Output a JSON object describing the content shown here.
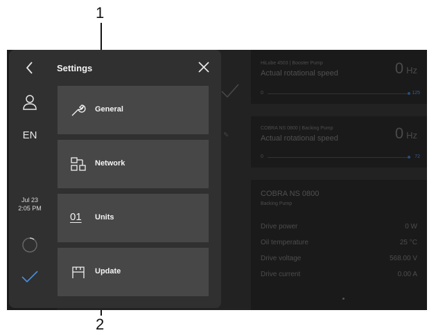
{
  "callouts": {
    "top": "1",
    "bottom": "2"
  },
  "settings": {
    "title": "Settings",
    "language": "EN",
    "date": "Jul 23",
    "time": "2:05 PM",
    "menu": [
      {
        "label": "General",
        "icon": "wrench-icon"
      },
      {
        "label": "Network",
        "icon": "network-icon"
      },
      {
        "label": "Units",
        "icon": "units-icon",
        "icon_text": "01"
      },
      {
        "label": "Update",
        "icon": "update-icon"
      }
    ]
  },
  "dashboard": {
    "pump1": {
      "name": "HiLobe 4503 | Booster Pump",
      "label": "Actual rotational speed",
      "value": "0",
      "unit": "Hz",
      "min": "0",
      "max": "125"
    },
    "pump2": {
      "name": "COBRA NS 0800 | Backing Pump",
      "label": "Actual rotational speed",
      "value": "0",
      "unit": "Hz",
      "min": "0",
      "max": "72"
    },
    "details": {
      "title": "COBRA NS 0800",
      "subtitle": "Backing Pump",
      "rows": [
        {
          "label": "Drive power",
          "value": "0 W"
        },
        {
          "label": "Oil temperature",
          "value": "25 °C"
        },
        {
          "label": "Drive voltage",
          "value": "568.00 V"
        },
        {
          "label": "Drive current",
          "value": "0.00 A"
        }
      ]
    }
  },
  "colors": {
    "accent": "#4a90e2",
    "overlay": "#303030",
    "tile": "#474747",
    "background": "#222222"
  }
}
